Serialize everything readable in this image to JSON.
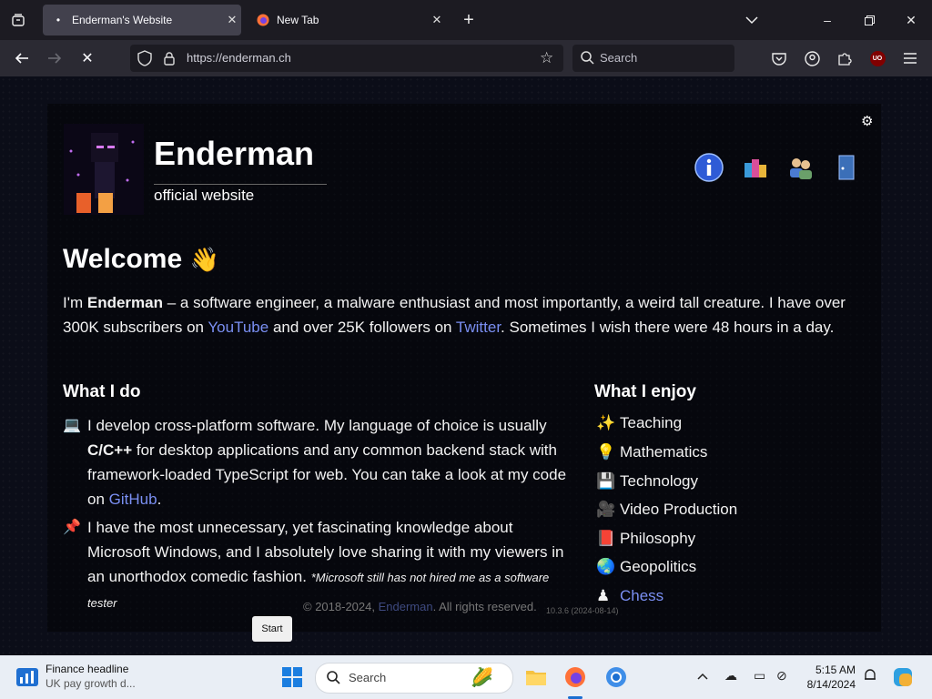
{
  "browser": {
    "tabs": [
      {
        "title": "Enderman's Website",
        "active": true
      },
      {
        "title": "New Tab",
        "active": false
      }
    ],
    "url": "https://enderman.ch",
    "search_placeholder": "Search",
    "ublock_badge": "UO"
  },
  "site": {
    "brand": "Enderman",
    "tagline": "official website",
    "welcome": "Welcome",
    "welcome_emoji": "👋",
    "intro": {
      "p1": "I'm ",
      "name": "Enderman",
      "p2": " – a software engineer, a malware enthusiast and most importantly, a weird tall creature. I have over 300K subscribers on ",
      "youtube": "YouTube",
      "p3": " and over 25K followers on ",
      "twitter": "Twitter",
      "p4": ". Sometimes I wish there were 48 hours in a day."
    },
    "what_i_do": {
      "heading": "What I do",
      "item1": {
        "emoji": "💻",
        "t1": "I develop cross-platform software. My language of choice is usually ",
        "bold": "C/C++",
        "t2": " for desktop applications and any common backend stack with framework-loaded TypeScript for web. You can take a look at my code on ",
        "link": "GitHub",
        "t3": "."
      },
      "item2": {
        "emoji": "📌",
        "t1": "I have the most unnecessary, yet fascinating knowledge about Microsoft Windows, and I absolutely love sharing it with my viewers in an unorthodox comedic fashion. ",
        "note": "*Microsoft still has not hired me as a software tester"
      }
    },
    "what_i_enjoy": {
      "heading": "What I enjoy",
      "items": [
        {
          "emoji": "✨",
          "label": "Teaching"
        },
        {
          "emoji": "💡",
          "label": "Mathematics"
        },
        {
          "emoji": "💾",
          "label": "Technology"
        },
        {
          "emoji": "🎥",
          "label": "Video Production"
        },
        {
          "emoji": "📕",
          "label": "Philosophy"
        },
        {
          "emoji": "🌏",
          "label": "Geopolitics"
        },
        {
          "emoji": "♟",
          "label": "Chess"
        }
      ]
    },
    "footer": {
      "copyright": "© 2018-2024,",
      "link": "Enderman",
      "rights": ". All rights reserved.",
      "version": "10.3.6 (2024-08-14)"
    },
    "start_button": "Start"
  },
  "taskbar": {
    "widget_title": "Finance headline",
    "widget_sub": "UK pay growth d...",
    "search_placeholder": "Search",
    "time": "5:15 AM",
    "date": "8/14/2024"
  }
}
